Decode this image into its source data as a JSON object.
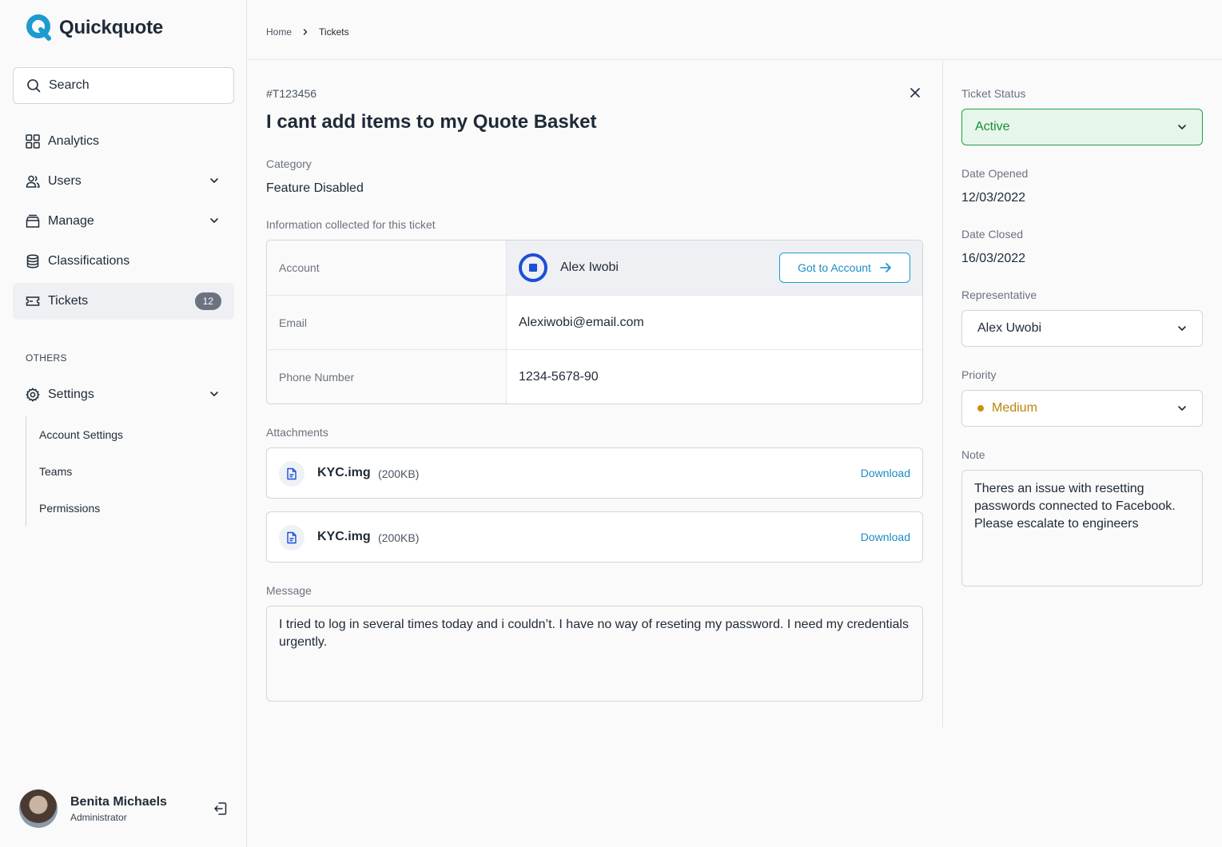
{
  "brand": {
    "name": "Quickquote",
    "accent": "#1d8cc4"
  },
  "search": {
    "placeholder": "Search"
  },
  "sidebar": {
    "items": [
      {
        "label": "Analytics",
        "icon": "grid-icon"
      },
      {
        "label": "Users",
        "icon": "users-icon"
      },
      {
        "label": "Manage",
        "icon": "box-icon"
      },
      {
        "label": "Classifications",
        "icon": "database-icon"
      },
      {
        "label": "Tickets",
        "icon": "ticket-icon",
        "badge": "12",
        "active": true
      }
    ],
    "others_label": "OTHERS",
    "settings": {
      "label": "Settings",
      "icon": "gear-icon",
      "children": [
        "Account Settings",
        "Teams",
        "Permissions"
      ]
    }
  },
  "user": {
    "name": "Benita Michaels",
    "role": "Administrator"
  },
  "breadcrumb": {
    "home": "Home",
    "current": "Tickets"
  },
  "ticket": {
    "id": "#T123456",
    "title": "I cant add items to my Quote Basket",
    "category_label": "Category",
    "category": "Feature Disabled",
    "info_label": "Information collected for this ticket",
    "info": {
      "account_key": "Account",
      "account_name": "Alex Iwobi",
      "goto_label": "Got to Account",
      "email_key": "Email",
      "email": "Alexiwobi@email.com",
      "phone_key": "Phone Number",
      "phone": "1234-5678-90"
    },
    "attachments_label": "Attachments",
    "attachments": [
      {
        "name": "KYC.img",
        "size": "(200KB)",
        "action": "Download"
      },
      {
        "name": "KYC.img",
        "size": "(200KB)",
        "action": "Download"
      }
    ],
    "message_label": "Message",
    "message": "I tried to log in several times today and i couldn’t. I have no way of reseting my password. I need my credentials urgently."
  },
  "details": {
    "status_label": "Ticket Status",
    "status": "Active",
    "status_color": "#22a045",
    "date_opened_label": "Date Opened",
    "date_opened": "12/03/2022",
    "date_closed_label": "Date Closed",
    "date_closed": "16/03/2022",
    "representative_label": "Representative",
    "representative": "Alex Uwobi",
    "priority_label": "Priority",
    "priority": "Medium",
    "priority_color": "#c9920f",
    "note_label": "Note",
    "note": "Theres an issue with resetting passwords connected to Facebook. Please escalate to engineers"
  }
}
